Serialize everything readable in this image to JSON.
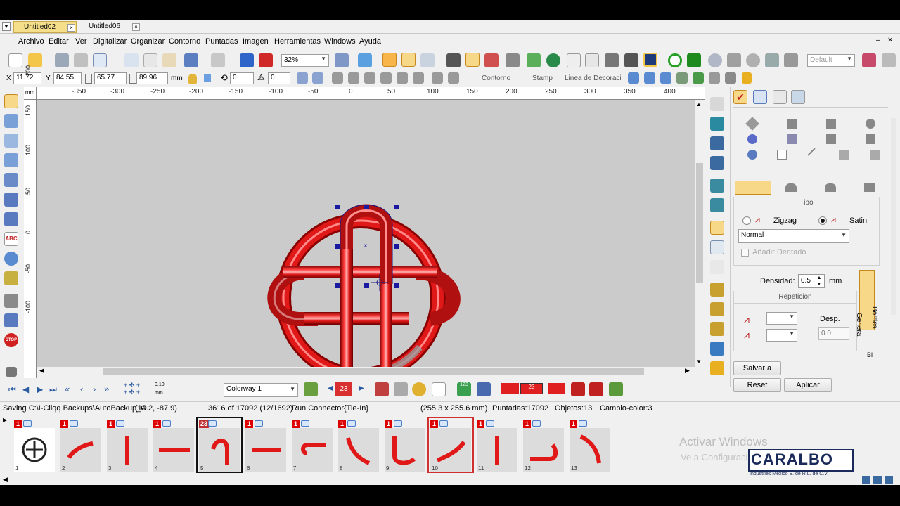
{
  "tabs": [
    {
      "label": "Untitled02",
      "active": true
    },
    {
      "label": "Untitled06",
      "active": false
    }
  ],
  "menu": [
    "Archivo",
    "Editar",
    "Ver",
    "Digitalizar",
    "Organizar",
    "Contorno",
    "Puntadas",
    "Imagen",
    "Herramientas",
    "Windows",
    "Ayuda"
  ],
  "toolbar": {
    "zoom": "32%",
    "style_select": "Default"
  },
  "props": {
    "x_label": "X",
    "x_value": "11.72",
    "y_label": "Y",
    "y_value": "84.55",
    "w_value": "65.77",
    "h_value": "89.96",
    "unit": "mm",
    "rotate_value": "0",
    "slant_value": "0",
    "contorno": "Contorno",
    "stamp": "Stamp",
    "linea": "Linea de Decoraci"
  },
  "ruler_top": [
    "-350",
    "-300",
    "-250",
    "-200",
    "-150",
    "-100",
    "-50",
    "0",
    "50",
    "100",
    "150",
    "200",
    "250",
    "300",
    "350",
    "400"
  ],
  "ruler_left": [
    "200",
    "150",
    "100",
    "50",
    "0",
    "-50",
    "-100"
  ],
  "ruler_corner": "mm",
  "panel": {
    "tipo_header": "Tipo",
    "zigzag_label": "Zigzag",
    "satin_label": "Satin",
    "normal_select": "Normal",
    "anadir_dentado": "Añadir Dentado",
    "densidad_label": "Densidad:",
    "densidad_value": "0.5",
    "densidad_unit": "mm",
    "repeticion_header": "Repeticion",
    "desp_label": "Desp.",
    "desp_value": "0.0",
    "side_tab_general": "General",
    "side_tab_bordes": "Bordes",
    "side_tab_bl": "Bl",
    "salvar_button": "Salvar a",
    "reset_button": "Reset",
    "aplicar_button": "Aplicar"
  },
  "nav": {
    "step_value": "0.10",
    "step_unit": "mm",
    "colorway": "Colorway 1",
    "color_number": "23"
  },
  "status": {
    "saving": "Saving C:\\I-Cliqq Backups\\AutoBackup_O",
    "coords": "(14.2, -87.9)",
    "stitch_count": "3616 of 17092 (12/1692)",
    "stitch_type": "Run Connector{Tie-In}",
    "size": "(255.3 x 255.6 mm)",
    "puntadas": "Puntadas:17092",
    "objetos": "Objetos:13",
    "cambio_color": "Cambio-color:3"
  },
  "thumbnails": [
    {
      "badge": "1",
      "index": "1"
    },
    {
      "badge": "1",
      "index": "2"
    },
    {
      "badge": "1",
      "index": "3"
    },
    {
      "badge": "1",
      "index": "4"
    },
    {
      "badge": "23",
      "index": "5"
    },
    {
      "badge": "1",
      "index": "6"
    },
    {
      "badge": "1",
      "index": "7"
    },
    {
      "badge": "1",
      "index": "8"
    },
    {
      "badge": "1",
      "index": "9"
    },
    {
      "badge": "1",
      "index": "10"
    },
    {
      "badge": "1",
      "index": "11"
    },
    {
      "badge": "1",
      "index": "12"
    },
    {
      "badge": "1",
      "index": "13"
    }
  ],
  "watermark": {
    "line1": "Activar Windows",
    "line2": "Ve a Configuraci"
  },
  "logo": {
    "brand": "CARALBO",
    "sub": "Industries México S. de R.L. de C.V."
  },
  "colors": {
    "embroidery_red": "#e01818",
    "canvas_bg": "#cbcbcb",
    "active_tab": "#f5df8a"
  }
}
